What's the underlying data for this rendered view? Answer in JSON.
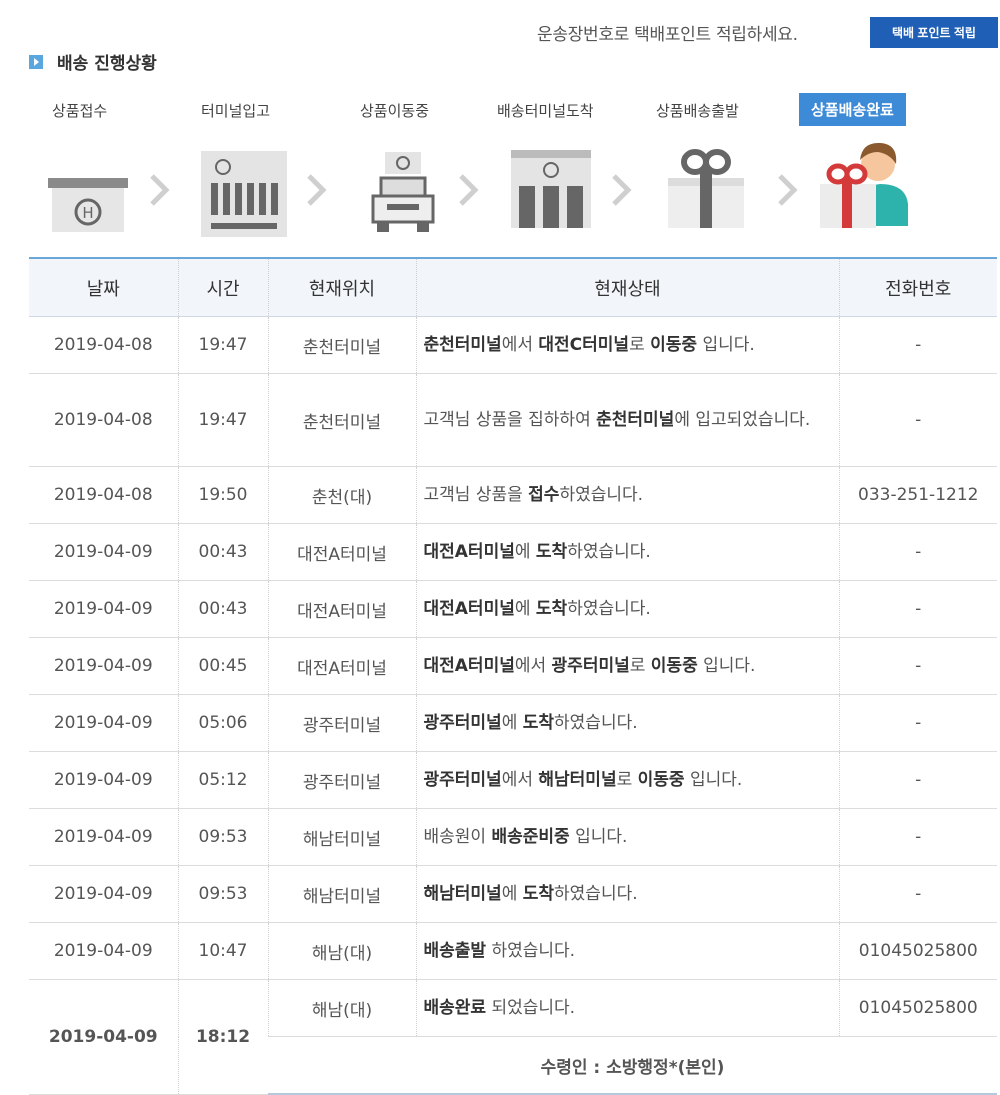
{
  "header": {
    "notice": "운송장번호로 택배포인트 적립하세요.",
    "points_button": "택배 포인트 적립",
    "section_title": "배송 진행상황"
  },
  "steps": [
    {
      "label": "상품접수",
      "icon": "reception-building-icon"
    },
    {
      "label": "터미널입고",
      "icon": "terminal-icon"
    },
    {
      "label": "상품이동중",
      "icon": "truck-icon"
    },
    {
      "label": "배송터미널도착",
      "icon": "delivery-terminal-icon"
    },
    {
      "label": "상품배송출발",
      "icon": "gift-box-icon"
    },
    {
      "label": "상품배송완료",
      "icon": "delivered-person-icon",
      "active": true
    }
  ],
  "table": {
    "headers": [
      "날짜",
      "시간",
      "현재위치",
      "현재상태",
      "전화번호"
    ],
    "rows": [
      {
        "date": "2019-04-08",
        "time": "19:47",
        "location": "춘천터미널",
        "status": [
          [
            "b",
            "춘천터미널"
          ],
          [
            "t",
            "에서 "
          ],
          [
            "b",
            "대전C터미널"
          ],
          [
            "t",
            "로 "
          ],
          [
            "b",
            "이동중"
          ],
          [
            "t",
            " 입니다."
          ]
        ],
        "phone": "-"
      },
      {
        "date": "2019-04-08",
        "time": "19:47",
        "location": "춘천터미널",
        "status": [
          [
            "t",
            "고객님 상품을 집하하여 "
          ],
          [
            "b",
            "춘천터미널"
          ],
          [
            "t",
            "에 입고되었습니다."
          ]
        ],
        "phone": "-",
        "tall": true
      },
      {
        "date": "2019-04-08",
        "time": "19:50",
        "location": "춘천(대)",
        "status": [
          [
            "t",
            "고객님 상품을 "
          ],
          [
            "b",
            "접수"
          ],
          [
            "t",
            "하였습니다."
          ]
        ],
        "phone": "033-251-1212"
      },
      {
        "date": "2019-04-09",
        "time": "00:43",
        "location": "대전A터미널",
        "status": [
          [
            "b",
            "대전A터미널"
          ],
          [
            "t",
            "에 "
          ],
          [
            "b",
            "도착"
          ],
          [
            "t",
            "하였습니다."
          ]
        ],
        "phone": "-"
      },
      {
        "date": "2019-04-09",
        "time": "00:43",
        "location": "대전A터미널",
        "status": [
          [
            "b",
            "대전A터미널"
          ],
          [
            "t",
            "에 "
          ],
          [
            "b",
            "도착"
          ],
          [
            "t",
            "하였습니다."
          ]
        ],
        "phone": "-"
      },
      {
        "date": "2019-04-09",
        "time": "00:45",
        "location": "대전A터미널",
        "status": [
          [
            "b",
            "대전A터미널"
          ],
          [
            "t",
            "에서 "
          ],
          [
            "b",
            "광주터미널"
          ],
          [
            "t",
            "로 "
          ],
          [
            "b",
            "이동중"
          ],
          [
            "t",
            " 입니다."
          ]
        ],
        "phone": "-"
      },
      {
        "date": "2019-04-09",
        "time": "05:06",
        "location": "광주터미널",
        "status": [
          [
            "b",
            "광주터미널"
          ],
          [
            "t",
            "에 "
          ],
          [
            "b",
            "도착"
          ],
          [
            "t",
            "하였습니다."
          ]
        ],
        "phone": "-"
      },
      {
        "date": "2019-04-09",
        "time": "05:12",
        "location": "광주터미널",
        "status": [
          [
            "b",
            "광주터미널"
          ],
          [
            "t",
            "에서 "
          ],
          [
            "b",
            "해남터미널"
          ],
          [
            "t",
            "로 "
          ],
          [
            "b",
            "이동중"
          ],
          [
            "t",
            " 입니다."
          ]
        ],
        "phone": "-"
      },
      {
        "date": "2019-04-09",
        "time": "09:53",
        "location": "해남터미널",
        "status": [
          [
            "t",
            "배송원이 "
          ],
          [
            "b",
            "배송준비중"
          ],
          [
            "t",
            " 입니다."
          ]
        ],
        "phone": "-"
      },
      {
        "date": "2019-04-09",
        "time": "09:53",
        "location": "해남터미널",
        "status": [
          [
            "b",
            "해남터미널"
          ],
          [
            "t",
            "에 "
          ],
          [
            "b",
            "도착"
          ],
          [
            "t",
            "하였습니다."
          ]
        ],
        "phone": "-"
      },
      {
        "date": "2019-04-09",
        "time": "10:47",
        "location": "해남(대)",
        "status": [
          [
            "b",
            "배송출발"
          ],
          [
            "t",
            " 하였습니다."
          ]
        ],
        "phone": "01045025800"
      }
    ],
    "final": {
      "date": "2019-04-09",
      "time": "18:12",
      "location": "해남(대)",
      "status": [
        [
          "b",
          "배송완료"
        ],
        [
          "t",
          " 되었습니다."
        ]
      ],
      "phone": "01045025800",
      "receiver": "수령인 : 소방행정*(본인)"
    }
  },
  "colors": {
    "accent": "#1f5fb5",
    "active_step": "#3d8bd6",
    "final_text": "#2a74c7"
  }
}
